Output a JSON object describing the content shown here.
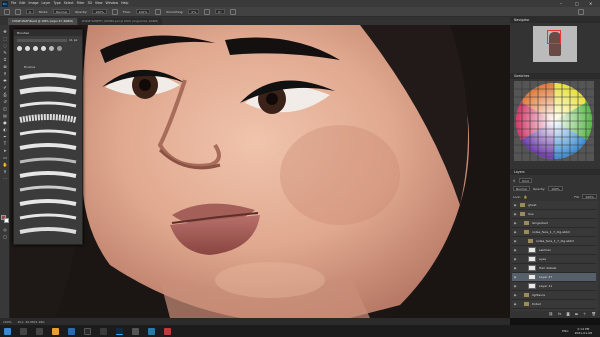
{
  "menubar": {
    "items": [
      "File",
      "Edit",
      "Image",
      "Layer",
      "Type",
      "Select",
      "Filter",
      "3D",
      "View",
      "Window",
      "Help"
    ],
    "logo": "Ps"
  },
  "options": {
    "brush_size": "9",
    "mode_label": "Mode:",
    "mode_value": "Normal",
    "opacity_label": "Opacity:",
    "opacity_value": "100%",
    "flow_label": "Flow:",
    "flow_value": "100%",
    "smoothing_label": "Smoothing:",
    "smoothing_value": "0%",
    "angle_value": "0°"
  },
  "tabs": [
    {
      "label": "CHASE MAXFIN.psd @ 100% (Layer 27, RGB/8)",
      "active": true
    },
    {
      "label": "CHASE SOMETH. ODWRS.psd @ 100% (Ungeomed, RGB/8)",
      "active": false
    }
  ],
  "brushes_panel": {
    "title": "Brushes",
    "size_value": "11 px",
    "folder_label": "Brushes"
  },
  "right_panel": {
    "navigator_title": "Navigator",
    "swatches_title": "Swatches",
    "layers_title": "Layers",
    "kind_label": "Kind",
    "blend_value": "Normal",
    "opacity_label": "Opacity:",
    "opacity_value": "100%",
    "lock_label": "Lock:",
    "fill_label": "Fill:",
    "fill_value": "100%",
    "layers": [
      {
        "name": "ghost",
        "type": "folder",
        "indent": 0
      },
      {
        "name": "line",
        "type": "folder",
        "indent": 0
      },
      {
        "name": "Gingerbed",
        "type": "folder",
        "indent": 1
      },
      {
        "name": "notsa_face_1_7_dig.abbd",
        "type": "folder",
        "indent": 1
      },
      {
        "name": "notsa_face_1_7_dig.abbd",
        "type": "folder",
        "indent": 2
      },
      {
        "name": "samhan",
        "type": "layer",
        "indent": 2
      },
      {
        "name": "eyes",
        "type": "layer",
        "indent": 2
      },
      {
        "name": "Hair details",
        "type": "layer",
        "indent": 2
      },
      {
        "name": "Layer 27",
        "type": "layer",
        "indent": 2,
        "active": true
      },
      {
        "name": "Layer 11",
        "type": "layer",
        "indent": 2
      },
      {
        "name": "lightsure",
        "type": "folder",
        "indent": 1
      },
      {
        "name": "tinted",
        "type": "folder",
        "indent": 1
      },
      {
        "name": "posing",
        "type": "folder",
        "indent": 1
      }
    ]
  },
  "status": {
    "zoom": "100%",
    "doc_info": "Doc: 20.0M/1.18G"
  },
  "taskbar": {
    "time": "2:14 PM",
    "date": "2021-01-08",
    "lang": "ENG"
  },
  "colors": {
    "foreground": "#9a4a3e",
    "background": "#ffffff",
    "accent": "#31a8ff"
  }
}
